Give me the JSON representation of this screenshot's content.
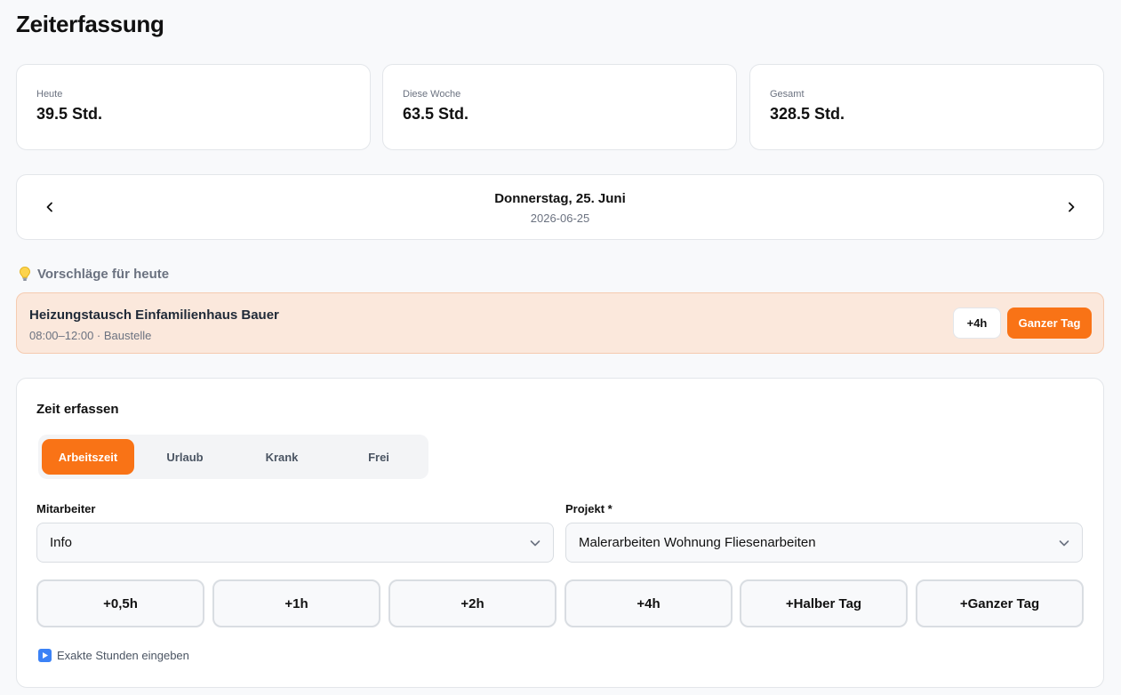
{
  "page": {
    "title": "Zeiterfassung"
  },
  "stats": [
    {
      "label": "Heute",
      "value": "39.5 Std."
    },
    {
      "label": "Diese Woche",
      "value": "63.5 Std."
    },
    {
      "label": "Gesamt",
      "value": "328.5 Std."
    }
  ],
  "date_nav": {
    "day_label": "Donnerstag, 25. Juni",
    "iso_date": "2026-06-25",
    "prev_icon": "chevron-left-icon",
    "next_icon": "chevron-right-icon"
  },
  "suggestions": {
    "heading": "Vorschläge für heute",
    "heading_icon": "lightbulb-icon",
    "items": [
      {
        "title": "Heizungstausch Einfamilienhaus Bauer",
        "meta": "08:00–12:00 · Baustelle",
        "add_4h_label": "+4h",
        "full_day_label": "Ganzer Tag"
      }
    ]
  },
  "entry": {
    "title": "Zeit erfassen",
    "tabs": [
      {
        "label": "Arbeitszeit",
        "active": true
      },
      {
        "label": "Urlaub",
        "active": false
      },
      {
        "label": "Krank",
        "active": false
      },
      {
        "label": "Frei",
        "active": false
      }
    ],
    "employee": {
      "label": "Mitarbeiter",
      "value": "Info"
    },
    "project": {
      "label": "Projekt *",
      "value": "Malerarbeiten Wohnung Fliesenarbeiten"
    },
    "quick_buttons": [
      "+0,5h",
      "+1h",
      "+2h",
      "+4h",
      "+Halber Tag",
      "+Ganzer Tag"
    ],
    "exact_hours_label": "Exakte Stunden eingeben"
  },
  "colors": {
    "accent": "#f97316",
    "suggestion_bg": "#fbe8dc",
    "exact_icon": "#3b82f6"
  }
}
